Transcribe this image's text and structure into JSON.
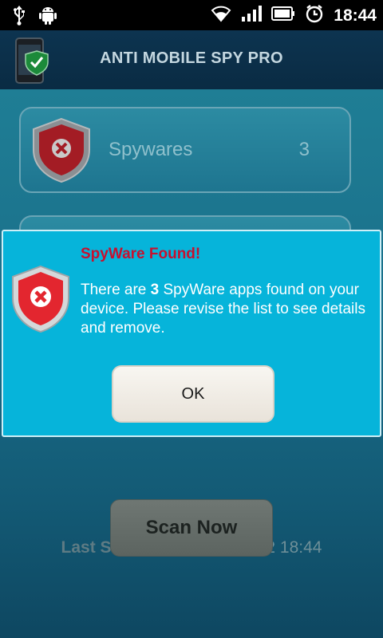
{
  "status_bar": {
    "time": "18:44",
    "icons": [
      "usb-icon",
      "android-debug-icon",
      "wifi-icon",
      "signal-icon",
      "battery-icon",
      "alarm-clock-icon"
    ]
  },
  "header": {
    "title": "ANTI MOBILE SPY PRO"
  },
  "main": {
    "spyware_card": {
      "label": "Spywares",
      "count": "3"
    },
    "last_scan": {
      "label": "Last Scan Date:",
      "value": "31/05/2012 18:44"
    },
    "scan_button": "Scan Now"
  },
  "dialog": {
    "title": "SpyWare Found!",
    "message_prefix": "There are ",
    "message_count": "3",
    "message_suffix": " SpyWare apps found on your device. Please revise the list to see details and remove.",
    "ok_label": "OK"
  },
  "colors": {
    "dialog_bg": "#06b4da",
    "title_red": "#c8102e",
    "shield_red": "#e3262f"
  }
}
